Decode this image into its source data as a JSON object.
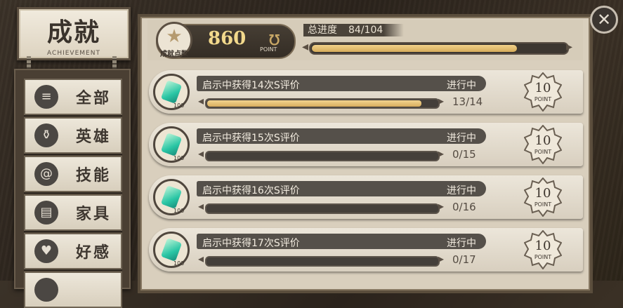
{
  "title": {
    "zh": "成就",
    "en": "ACHIEVEMENT"
  },
  "sidebar": {
    "items": [
      {
        "label": "全部",
        "icon": "books-icon"
      },
      {
        "label": "英雄",
        "icon": "potion-icon"
      },
      {
        "label": "技能",
        "icon": "swirl-icon"
      },
      {
        "label": "家具",
        "icon": "cabinet-icon"
      },
      {
        "label": "好感",
        "icon": "hearts-icon"
      }
    ]
  },
  "points": {
    "caption": "成就点数",
    "value": "860",
    "unit": "POINT"
  },
  "progress": {
    "label": "总进度",
    "count": "84/104",
    "fraction": 0.808
  },
  "achievements": [
    {
      "title": "启示中获得14次S评价",
      "status": "进行中",
      "count": "13/14",
      "fraction": 0.929,
      "points": "10",
      "points_unit": "POINT",
      "quantity": "100"
    },
    {
      "title": "启示中获得15次S评价",
      "status": "进行中",
      "count": "0/15",
      "fraction": 0,
      "points": "10",
      "points_unit": "POINT",
      "quantity": "100"
    },
    {
      "title": "启示中获得16次S评价",
      "status": "进行中",
      "count": "0/16",
      "fraction": 0,
      "points": "10",
      "points_unit": "POINT",
      "quantity": "100"
    },
    {
      "title": "启示中获得17次S评价",
      "status": "进行中",
      "count": "0/17",
      "fraction": 0,
      "points": "10",
      "points_unit": "POINT",
      "quantity": "100"
    }
  ],
  "colors": {
    "accent_gold": "#e6c06f",
    "gem": "#2ac6a5"
  }
}
